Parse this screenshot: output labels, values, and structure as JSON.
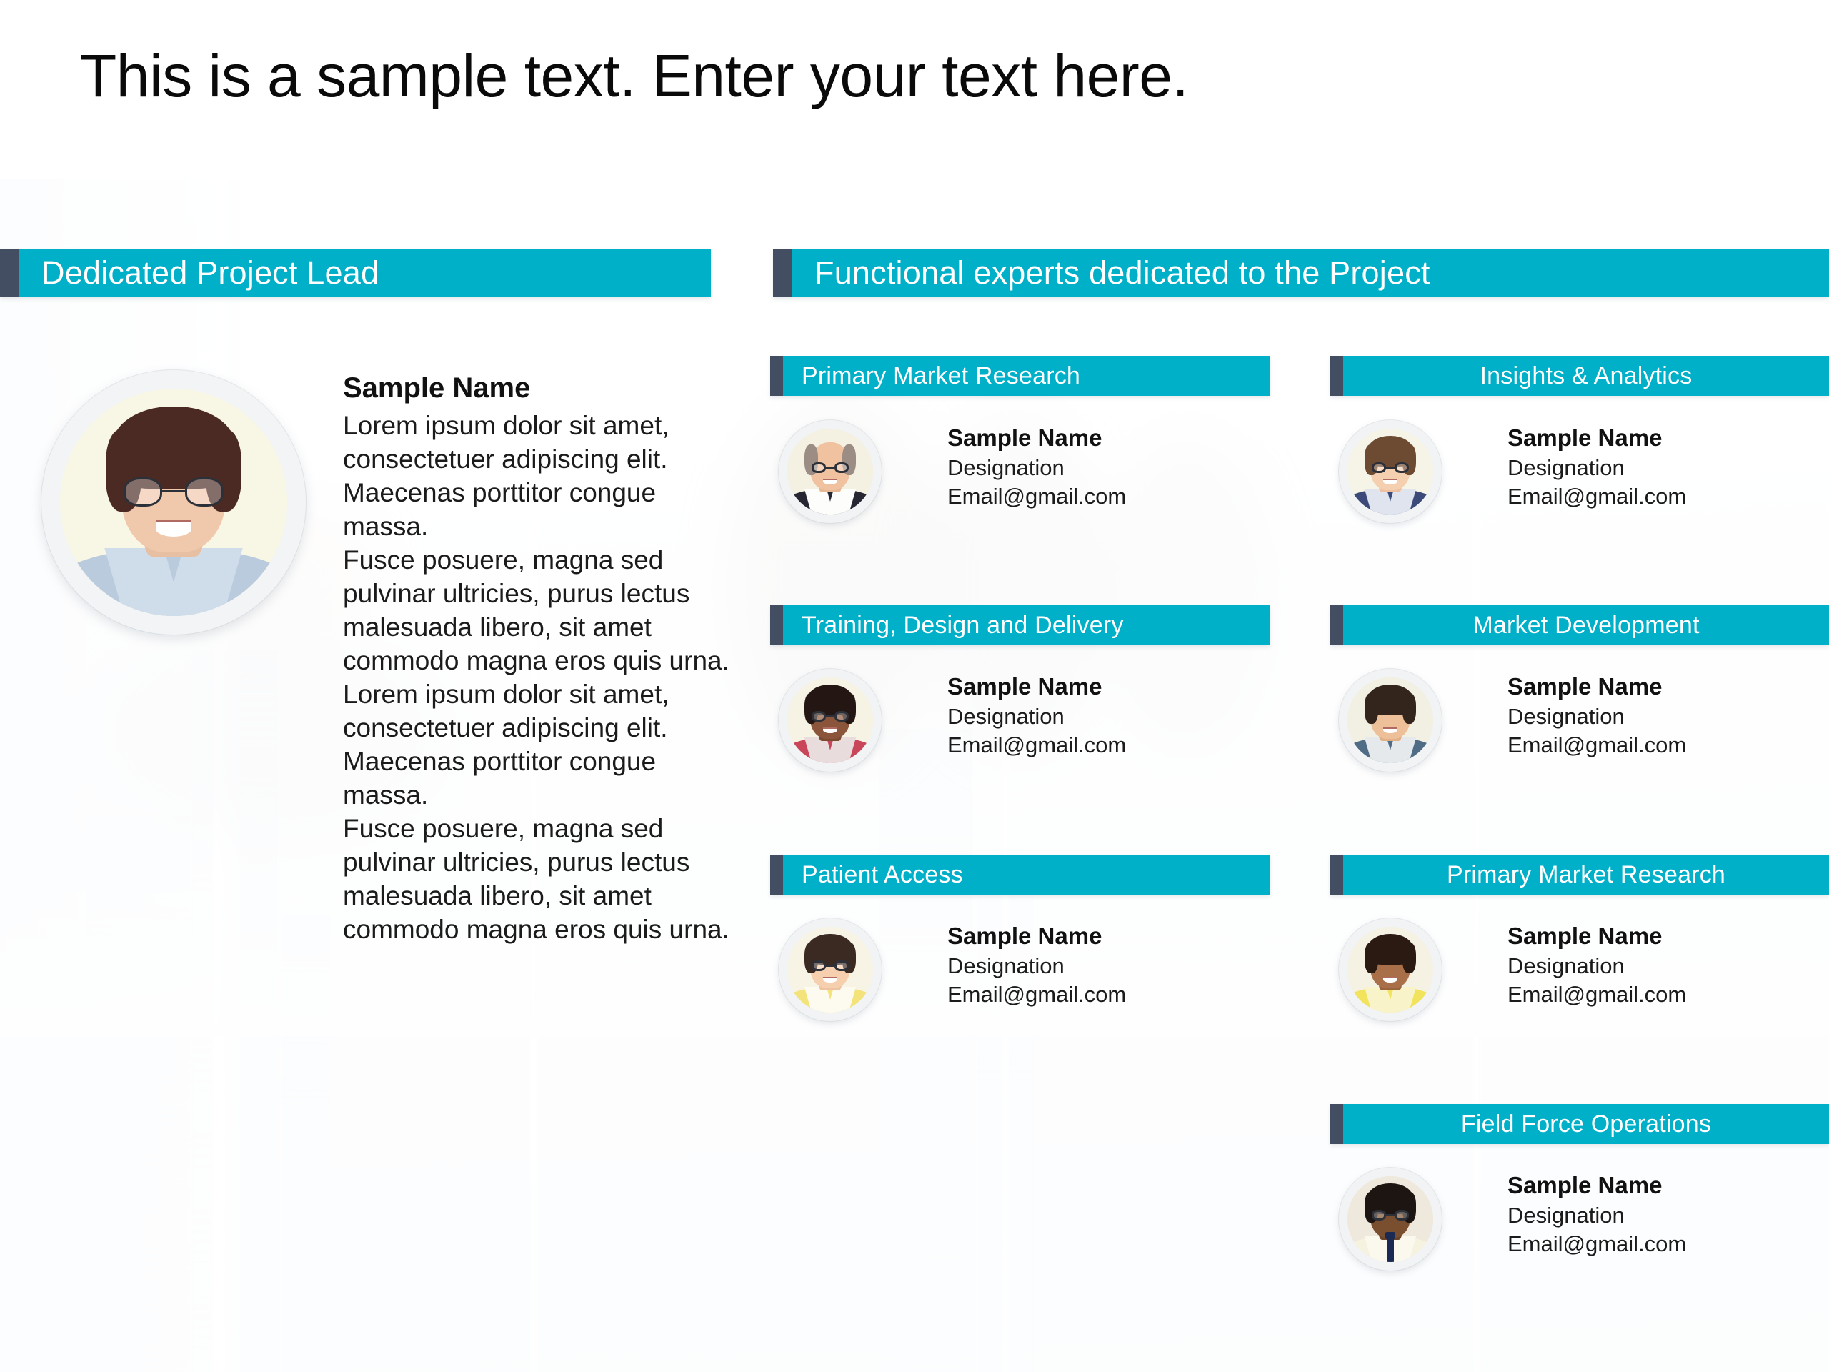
{
  "slide": {
    "title": "This is a sample text. Enter your text here.",
    "colors": {
      "accent_teal": "#00AFC8",
      "accent_navy": "#434E63",
      "banner_text": "#FFFFFF",
      "body_text": "#1B1B1B",
      "background": "#FFFFFF"
    }
  },
  "left_section": {
    "header": "Dedicated Project Lead",
    "lead": {
      "photo_alt": "project-lead-portrait",
      "name": "Sample Name",
      "paragraphs": [
        "Lorem ipsum dolor sit amet, consectetuer adipiscing elit. Maecenas porttitor congue massa.",
        "Fusce posuere, magna sed pulvinar ultricies, purus lectus malesuada libero, sit amet commodo magna eros quis urna.",
        "Lorem ipsum dolor sit amet, consectetuer adipiscing elit. Maecenas porttitor congue massa.",
        "Fusce posuere, magna sed pulvinar ultricies, purus lectus malesuada libero, sit amet commodo magna eros quis urna."
      ]
    }
  },
  "right_section": {
    "header": "Functional experts dedicated to the Project",
    "columns": [
      {
        "id": "col-left",
        "groups": [
          {
            "title": "Primary Market Research",
            "title_align": "left",
            "person": {
              "name": "Sample Name",
              "designation": "Designation",
              "email": "Email@gmail.com",
              "photo_alt": "expert-portrait-1"
            }
          },
          {
            "title": "Training, Design and Delivery",
            "title_align": "left",
            "person": {
              "name": "Sample Name",
              "designation": "Designation",
              "email": "Email@gmail.com",
              "photo_alt": "expert-portrait-3"
            }
          },
          {
            "title": "Patient Access",
            "title_align": "left",
            "person": {
              "name": "Sample Name",
              "designation": "Designation",
              "email": "Email@gmail.com",
              "photo_alt": "expert-portrait-5"
            }
          }
        ]
      },
      {
        "id": "col-right",
        "groups": [
          {
            "title": "Insights & Analytics",
            "title_align": "center",
            "person": {
              "name": "Sample Name",
              "designation": "Designation",
              "email": "Email@gmail.com",
              "photo_alt": "expert-portrait-2"
            }
          },
          {
            "title": "Market Development",
            "title_align": "center",
            "person": {
              "name": "Sample Name",
              "designation": "Designation",
              "email": "Email@gmail.com",
              "photo_alt": "expert-portrait-4"
            }
          },
          {
            "title": "Primary Market Research",
            "title_align": "center",
            "person": {
              "name": "Sample Name",
              "designation": "Designation",
              "email": "Email@gmail.com",
              "photo_alt": "expert-portrait-6"
            }
          },
          {
            "title": "Field Force Operations",
            "title_align": "center",
            "person": {
              "name": "Sample Name",
              "designation": "Designation",
              "email": "Email@gmail.com",
              "photo_alt": "expert-portrait-7"
            }
          }
        ]
      }
    ]
  }
}
